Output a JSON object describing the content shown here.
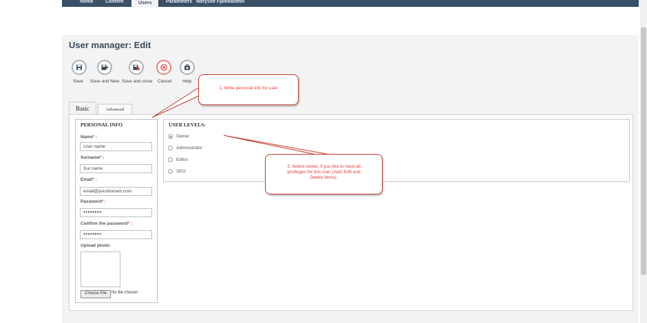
{
  "nav": {
    "items": [
      {
        "label": "Home"
      },
      {
        "label": "Content"
      },
      {
        "label": "Users"
      },
      {
        "label": "Parameters"
      },
      {
        "label": "Ndryshe Fjalëkalimin"
      }
    ],
    "active": "Users"
  },
  "page": {
    "title": "User manager: Edit"
  },
  "toolbar": {
    "buttons": [
      {
        "label": "Save",
        "icon": "floppy-disk-icon"
      },
      {
        "label": "Save and New",
        "icon": "floppy-arrow-icon"
      },
      {
        "label": "Save and close",
        "icon": "floppy-close-icon"
      },
      {
        "label": "Cancel",
        "icon": "cancel-x-icon"
      },
      {
        "label": "Help",
        "icon": "help-lifebuoy-icon"
      }
    ]
  },
  "tabs": {
    "basic": "Basic",
    "advanced": "Advanced"
  },
  "personal_info": {
    "title": "PERSONAL INFO",
    "name_label": "Name",
    "name_value": "User name",
    "surname_label": "Surname",
    "surname_value": "Sur name",
    "email_label": "Email",
    "email_value": "email@yourdomain.com",
    "password_label": "Password",
    "password_value": "••••••••",
    "confirm_label": "Confirm the password",
    "confirm_value": "••••••••",
    "required_mark": "*",
    "colon": " :",
    "upload_label": "Upload photo:",
    "choose_file": "Choose File",
    "no_file": "No file chosen"
  },
  "user_levels": {
    "title": "USER LEVELS:",
    "options": [
      {
        "label": "Owner",
        "checked": true
      },
      {
        "label": "Administrator",
        "checked": false
      },
      {
        "label": "Editor",
        "checked": false
      },
      {
        "label": "SEO",
        "checked": false
      }
    ]
  },
  "callouts": {
    "one": "1. Write perconal info for user",
    "two_line1": "2. Select owner, if you like to have all",
    "two_line2": "privileges for this user (Add, Edit and",
    "two_line3": "Delete items)."
  },
  "colors": {
    "nav_bg": "#3a5068",
    "callout_border": "#c0392b",
    "callout_text": "#e53935",
    "required": "#c0392b"
  }
}
